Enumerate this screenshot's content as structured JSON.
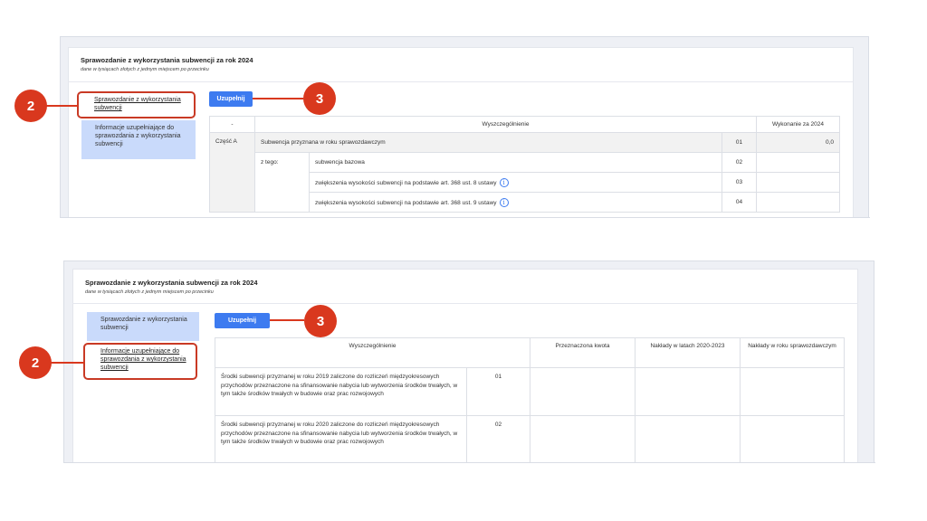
{
  "screen1": {
    "title": "Sprawozdanie z wykorzystania subwencji za rok 2024",
    "subtitle": "dane w tysiącach złotych z jednym miejscem po przecinku",
    "sidebar": [
      {
        "label": "Sprawozdanie z wykorzystania subwencji",
        "selected": true
      },
      {
        "label": "Informacje uzupełniające do sprawozdania z wykorzystania subwencji",
        "selected": false
      }
    ],
    "button_label": "Uzupełnij",
    "callout_a": "2",
    "callout_b": "3",
    "table": {
      "headers": [
        "-",
        "Wyszczególnienie",
        "Wykonanie za 2024"
      ],
      "part_label": "Część A",
      "ztego_label": "z tego:",
      "rows": [
        {
          "label": "Subwencja przyznana w roku sprawozdawczym",
          "num": "01",
          "value": "0,0"
        },
        {
          "label": "subwencja bazowa",
          "num": "02",
          "value": ""
        },
        {
          "label": "zwiększenia wysokości subwencji na podstawie art. 368 ust. 8 ustawy",
          "num": "03",
          "value": "",
          "info": true
        },
        {
          "label": "zwiększenia wysokości subwencji na podstawie art. 368 ust. 9 ustawy",
          "num": "04",
          "value": "",
          "info": true
        }
      ]
    }
  },
  "screen2": {
    "title": "Sprawozdanie z wykorzystania subwencji za rok 2024",
    "subtitle": "dane w tysiącach złotych z jednym miejscem po przecinku",
    "sidebar": [
      {
        "label": "Sprawozdanie z wykorzystania subwencji",
        "selected": false
      },
      {
        "label": "Informacje uzupełniające do sprawozdania z wykorzystania subwencji",
        "selected": true
      }
    ],
    "button_label": "Uzupełnij",
    "callout_a": "2",
    "callout_b": "3",
    "table": {
      "headers": [
        "Wyszczególnienie",
        "Przeznaczona kwota",
        "Nakłady w latach 2020-2023",
        "Nakłady w roku sprawozdawczym"
      ],
      "rows": [
        {
          "label": "Środki subwencji przyznanej w roku 2019 zaliczone do rozliczeń międzyokresowych przychodów przeznaczone na sfinansowanie nabycia lub wytworzenia środków trwałych, w tym także środków trwałych w budowie oraz prac rozwojowych",
          "num": "01"
        },
        {
          "label": "Środki subwencji przyznanej w roku 2020 zaliczone do rozliczeń międzyokresowych przychodów przeznaczone na sfinansowanie nabycia lub wytworzenia środków trwałych, w tym także środków trwałych w budowie oraz prac rozwojowych",
          "num": "02"
        }
      ]
    }
  },
  "icons": {
    "info": "info-icon"
  },
  "colors": {
    "accent": "#3d7bf0",
    "callout": "#d9381e",
    "selected_bg": "#c9dafb"
  }
}
